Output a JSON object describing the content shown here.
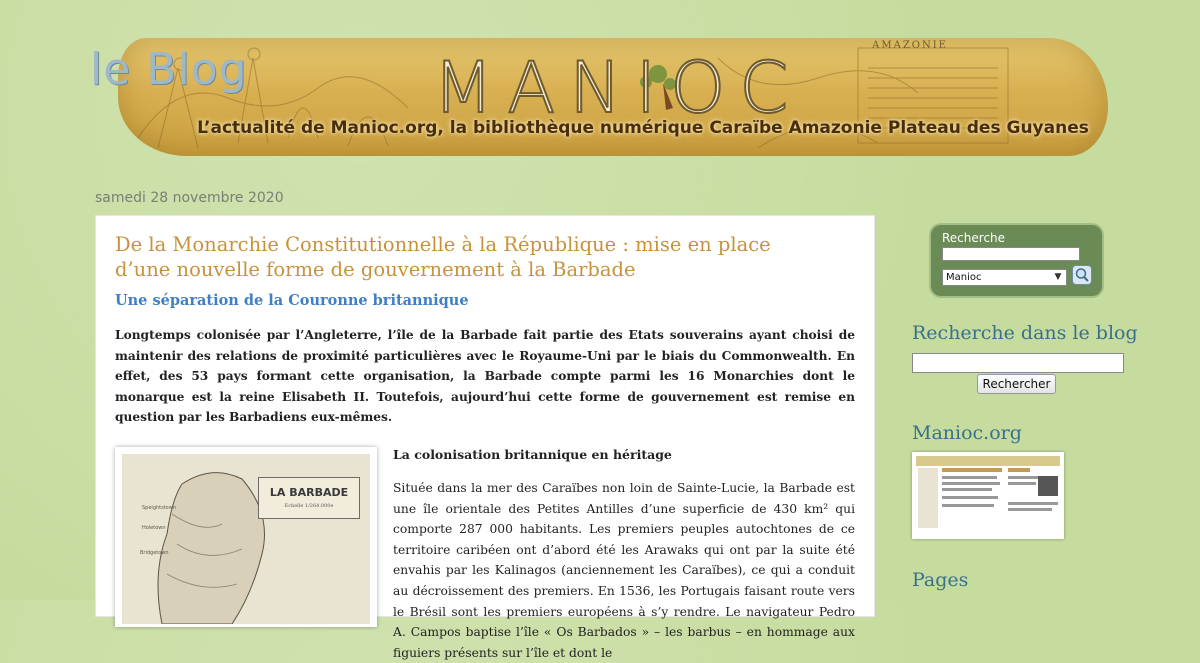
{
  "header": {
    "blog_word": "le Blog",
    "title": "MANIOC",
    "tagline": "L’actualité de Manioc.org, la bibliothèque numérique Caraïbe Amazonie Plateau des Guyanes",
    "banner_page_label": "AMAZONIE"
  },
  "post": {
    "date": "samedi 28 novembre 2020",
    "title": "De la Monarchie Constitutionnelle à la République : mise en place d’une nouvelle forme de gouvernement à la Barbade",
    "subtitle": "Une séparation de la Couronne britannique",
    "intro": "Longtemps colonisée par l’Angleterre, l’île de la Barbade fait partie des Etats souverains ayant choisi de maintenir des relations de proximité particulières avec le Royaume-Uni par le biais du Commonwealth. En effet, des 53 pays formant cette organisation, la Barbade compte parmi les 16 Monarchies dont le monarque est la reine Elisabeth II. Toutefois, aujourd’hui cette forme de gouvernement est remise en question par les Barbadiens eux-mêmes.",
    "map_label": "LA BARBADE",
    "map_scale": "Echelle 1/264.000e",
    "section_heading": "La colonisation britannique en héritage",
    "section_body": "Située dans la mer des Caraïbes non loin de Sainte-Lucie, la Barbade est une île orientale des Petites Antilles d’une superficie de 430 km² qui comporte 287 000 habitants. Les premiers peuples autochtones de ce territoire caribéen ont d’abord été les Arawaks qui ont par la suite été envahis par les Kalinagos (anciennement les Caraïbes), ce qui a conduit au décroissement des premiers. En 1536, les Portugais faisant route vers le Brésil sont les premiers européens à s’y rendre. Le navigateur Pedro A. Campos baptise l’île « Os Barbados » – les barbus – en hommage aux figuiers présents sur l’île et dont le"
  },
  "sidebar": {
    "search_widget": {
      "label": "Recherche",
      "select_value": "Manioc"
    },
    "blog_search": {
      "heading": "Recherche dans le blog",
      "button_label": "Rechercher"
    },
    "manioc_heading": "Manioc.org",
    "pages_heading": "Pages"
  },
  "colors": {
    "background": "#c6dc9e",
    "title": "#c7923a",
    "subtitle": "#3f7fc6",
    "sidebar_heading": "#3a6f8d",
    "widget": "#6a8b55"
  }
}
